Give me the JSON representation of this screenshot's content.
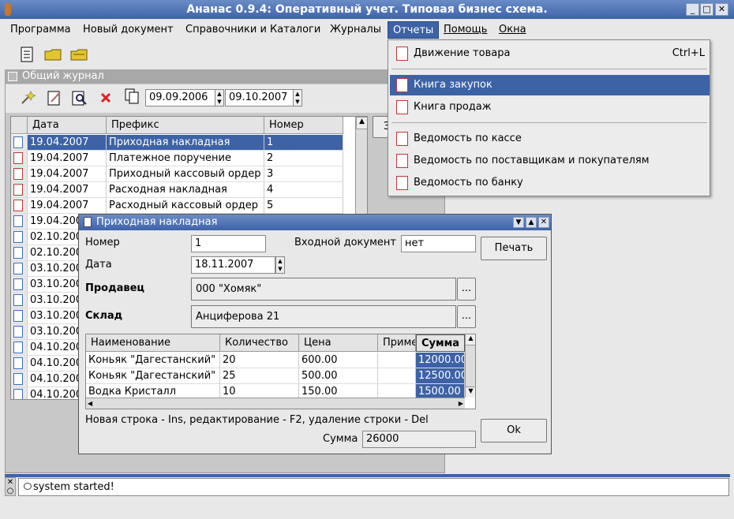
{
  "window": {
    "title": "Ананас 0.9.4: Оперативный учет. Типовая бизнес схема."
  },
  "menu": [
    "Программа",
    "Новый документ",
    "Справочники и Каталоги",
    "Журналы",
    "Отчеты",
    "Помощь",
    "Окна"
  ],
  "journal": {
    "title": "Общий журнал",
    "date_from": "09.09.2006",
    "date_to": "09.10.2007",
    "columns": [
      "Дата",
      "Префикс",
      "Номер"
    ],
    "rows": [
      {
        "date": "19.04.2007",
        "prefix": "Приходная накладная",
        "num": "1"
      },
      {
        "date": "19.04.2007",
        "prefix": "Платежное поручение",
        "num": "2"
      },
      {
        "date": "19.04.2007",
        "prefix": "Приходный кассовый ордер",
        "num": "3"
      },
      {
        "date": "19.04.2007",
        "prefix": "Расходная накладная",
        "num": "4"
      },
      {
        "date": "19.04.2007",
        "prefix": "Расходный кассовый ордер",
        "num": "5"
      },
      {
        "date": "19.04.200",
        "prefix": "",
        "num": ""
      },
      {
        "date": "02.10.200",
        "prefix": "",
        "num": ""
      },
      {
        "date": "02.10.200",
        "prefix": "",
        "num": ""
      },
      {
        "date": "03.10.200",
        "prefix": "",
        "num": ""
      },
      {
        "date": "03.10.200",
        "prefix": "",
        "num": ""
      },
      {
        "date": "03.10.200",
        "prefix": "",
        "num": ""
      },
      {
        "date": "03.10.200",
        "prefix": "",
        "num": ""
      },
      {
        "date": "03.10.200",
        "prefix": "",
        "num": ""
      },
      {
        "date": "04.10.200",
        "prefix": "",
        "num": ""
      },
      {
        "date": "04.10.200",
        "prefix": "",
        "num": ""
      },
      {
        "date": "04.10.200",
        "prefix": "",
        "num": ""
      },
      {
        "date": "04.10.200",
        "prefix": "",
        "num": ""
      }
    ],
    "side_button": "З"
  },
  "reports_menu": [
    {
      "label": "Движение товара",
      "shortcut": "Ctrl+L"
    },
    {
      "label": "Книга закупок",
      "shortcut": ""
    },
    {
      "label": "Книга продаж",
      "shortcut": ""
    },
    {
      "label": "Ведомость по кассе",
      "shortcut": ""
    },
    {
      "label": "Ведомость по поставщикам и покупателям",
      "shortcut": ""
    },
    {
      "label": "Ведомость по банку",
      "shortcut": ""
    }
  ],
  "dialog": {
    "title": "Приходная накладная",
    "number_label": "Номер",
    "number": "1",
    "incoming_label": "Входной документ",
    "incoming": "нет",
    "print_label": "Печать",
    "date_label": "Дата",
    "date": "18.11.2007",
    "seller_label": "Продавец",
    "seller": "000 \"Хомяк\"",
    "warehouse_label": "Склад",
    "warehouse": "Анциферова 21",
    "ellipsis": "...",
    "grid_columns": [
      "Наименование",
      "Количество",
      "Цена",
      "Примечание",
      "Сумма"
    ],
    "grid_rows": [
      {
        "name": "Коньяк \"Дагестанский\" п",
        "qty": "20",
        "price": "600.00",
        "note": "",
        "sum": "12000.00"
      },
      {
        "name": "Коньяк \"Дагестанский\" о",
        "qty": "25",
        "price": "500.00",
        "note": "",
        "sum": "12500.00"
      },
      {
        "name": "Водка Кристалл",
        "qty": "10",
        "price": "150.00",
        "note": "",
        "sum": "1500.00"
      }
    ],
    "hint": "Новая строка - Ins,  редактирование - F2, удаление строки - Del",
    "sum_label": "Сумма",
    "sum": "26000",
    "ok_label": "Ok"
  },
  "status": {
    "message": "system started!"
  }
}
